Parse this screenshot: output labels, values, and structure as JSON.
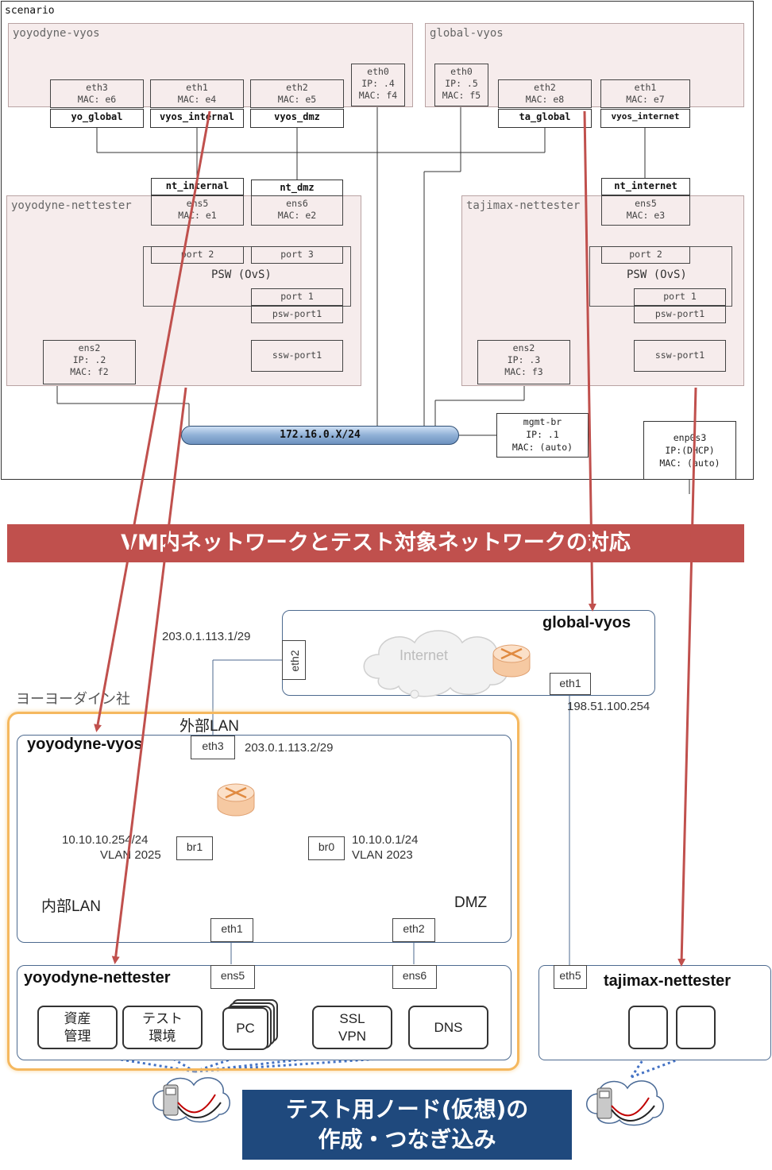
{
  "scenario": {
    "title": "scenario",
    "yoyodyne_vyos": {
      "label": "yoyodyne-vyos",
      "ifaces": [
        {
          "name": "eth3",
          "mac": "MAC: e6",
          "net": "yo_global"
        },
        {
          "name": "eth1",
          "mac": "MAC: e4",
          "net": "vyos_internal"
        },
        {
          "name": "eth2",
          "mac": "MAC: e5",
          "net": "vyos_dmz"
        }
      ],
      "eth0": {
        "name": "eth0",
        "ip": "IP: .4",
        "mac": "MAC: f4"
      }
    },
    "global_vyos": {
      "label": "global-vyos",
      "eth0": {
        "name": "eth0",
        "ip": "IP: .5",
        "mac": "MAC: f5"
      },
      "ifaces": [
        {
          "name": "eth2",
          "mac": "MAC: e8",
          "net": "ta_global"
        },
        {
          "name": "eth1",
          "mac": "MAC: e7",
          "net": "vyos_internet"
        }
      ]
    },
    "nt_internal": "nt_internal",
    "nt_dmz": "nt_dmz",
    "nt_internet": "nt_internet",
    "yoyodyne_nettester": {
      "label": "yoyodyne-nettester",
      "ens5": {
        "name": "ens5",
        "mac": "MAC: e1"
      },
      "ens6": {
        "name": "ens6",
        "mac": "MAC: e2"
      },
      "port2": "port 2",
      "port3": "port 3",
      "psw": "PSW (OvS)",
      "port1": "port 1",
      "psw_port1": "psw-port1",
      "ssw_port1": "ssw-port1",
      "ens2": {
        "name": "ens2",
        "ip": "IP: .2",
        "mac": "MAC: f2"
      }
    },
    "tajimax_nettester": {
      "label": "tajimax-nettester",
      "ens5": {
        "name": "ens5",
        "mac": "MAC: e3"
      },
      "port2": "port 2",
      "psw": "PSW (OvS)",
      "port1": "port 1",
      "psw_port1": "psw-port1",
      "ssw_port1": "ssw-port1",
      "ens2": {
        "name": "ens2",
        "ip": "IP: .3",
        "mac": "MAC: f3"
      }
    },
    "mgmt_net": "172.16.0.X/24",
    "mgmt_br": {
      "name": "mgmt-br",
      "ip": "IP: .1",
      "mac": "MAC: (auto)"
    },
    "enp0s3": {
      "name": "enp0s3",
      "ip": "IP:(DHCP)",
      "mac": "MAC: (auto)"
    }
  },
  "banner_top": "VM内ネットワークとテスト対象ネットワークの対応",
  "banner_bottom": {
    "line1": "テスト用ノード(仮想)の",
    "line2": "作成・つなぎ込み"
  },
  "colors": {
    "banner_red": "#c0504d",
    "banner_blue": "#1f497d",
    "arrow_red": "#c0504d",
    "company_orange": "#f5b85f"
  },
  "lower": {
    "global_vyos": {
      "label": "global-vyos",
      "eth2": "eth2",
      "eth1": "eth1",
      "cloud": "Internet",
      "ip_eth2": "203.0.1.113.1/29",
      "ip_eth1": "198.51.100.254"
    },
    "company": "ヨーヨーダイン社",
    "external_lan": "外部LAN",
    "yoyodyne_vyos": {
      "label": "yoyodyne-vyos",
      "eth3": "eth3",
      "eth3_ip": "203.0.1.113.2/29",
      "br1": "br1",
      "br1_ip": "10.10.10.254/24",
      "br1_vlan": "VLAN 2025",
      "br0": "br0",
      "br0_ip": "10.10.0.1/24",
      "br0_vlan": "VLAN 2023",
      "internal_lan": "内部LAN",
      "dmz": "DMZ",
      "eth1": "eth1",
      "eth2": "eth2"
    },
    "yoyodyne_nettester": {
      "label": "yoyodyne-nettester",
      "ens5": "ens5",
      "ens6": "ens6",
      "nodes": [
        {
          "l1": "資産",
          "l2": "管理"
        },
        {
          "l1": "テスト",
          "l2": "環境"
        },
        {
          "l1": "PC",
          "l2": ""
        },
        {
          "l1": "SSL",
          "l2": "VPN"
        },
        {
          "l1": "DNS",
          "l2": ""
        }
      ]
    },
    "tajimax_nettester": {
      "label": "tajimax-nettester",
      "eth5": "eth5"
    }
  }
}
